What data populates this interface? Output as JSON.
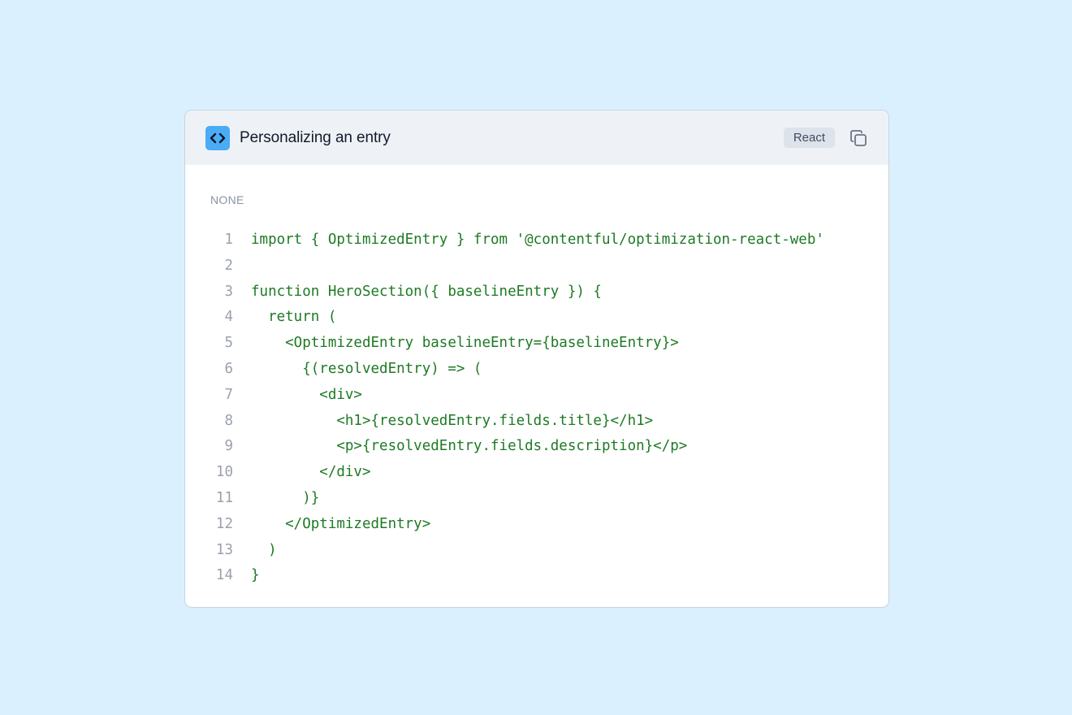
{
  "card": {
    "title": "Personalizing an entry",
    "language_badge": "React",
    "section_label": "NONE",
    "icons": {
      "code": "code-brackets-icon",
      "copy": "copy-icon"
    },
    "colors": {
      "background": "#daf0fe",
      "icon_bg": "#4cabf5",
      "code_text": "#1e7a24",
      "line_number": "#9aa1ad"
    }
  },
  "code": {
    "lines": [
      {
        "number": "1",
        "text": "import { OptimizedEntry } from '@contentful/optimization-react-web'"
      },
      {
        "number": "2",
        "text": ""
      },
      {
        "number": "3",
        "text": "function HeroSection({ baselineEntry }) {"
      },
      {
        "number": "4",
        "text": "  return ("
      },
      {
        "number": "5",
        "text": "    <OptimizedEntry baselineEntry={baselineEntry}>"
      },
      {
        "number": "6",
        "text": "      {(resolvedEntry) => ("
      },
      {
        "number": "7",
        "text": "        <div>"
      },
      {
        "number": "8",
        "text": "          <h1>{resolvedEntry.fields.title}</h1>"
      },
      {
        "number": "9",
        "text": "          <p>{resolvedEntry.fields.description}</p>"
      },
      {
        "number": "10",
        "text": "        </div>"
      },
      {
        "number": "11",
        "text": "      )}"
      },
      {
        "number": "12",
        "text": "    </OptimizedEntry>"
      },
      {
        "number": "13",
        "text": "  )"
      },
      {
        "number": "14",
        "text": "}"
      }
    ]
  }
}
